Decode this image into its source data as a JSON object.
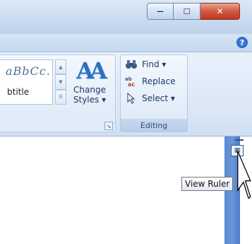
{
  "window": {
    "buttons": {
      "minimize": "—",
      "maximize": "☐",
      "close": "✕"
    },
    "help_icon": "?"
  },
  "styles_group": {
    "gallery_sample": "aBbCc.",
    "gallery_subtitle": "btitle",
    "change_styles_line1": "Change",
    "change_styles_line2": "Styles ▾",
    "launcher": "↘"
  },
  "editing_group": {
    "label": "Editing",
    "find": "Find ▾",
    "replace": "Replace",
    "select": "Select ▾"
  },
  "tooltip": {
    "text": "View Ruler"
  },
  "colors": {
    "accent": "#2d6fc0",
    "scrollbar": "#5a8ad1",
    "close": "#c0391f"
  }
}
